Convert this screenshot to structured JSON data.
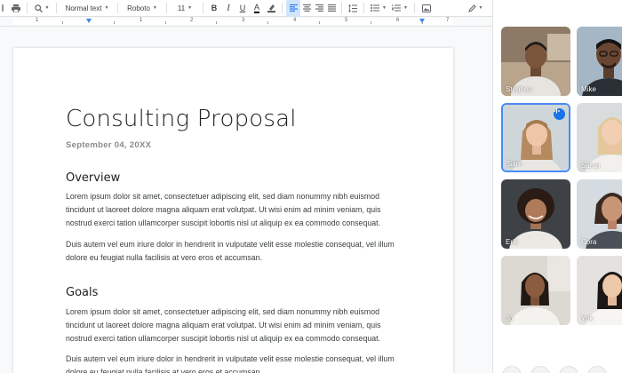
{
  "toolbar": {
    "style_select": "Normal text",
    "font_select": "Roboto",
    "font_size": "11",
    "bold": "B",
    "italic": "I",
    "underline": "U",
    "text_color": "A"
  },
  "ruler": {
    "labels": [
      "1",
      "1",
      "2",
      "3",
      "4",
      "5",
      "6",
      "7"
    ]
  },
  "document": {
    "title": "Consulting Proposal",
    "date": "September 04, 20XX",
    "sections": [
      {
        "heading": "Overview",
        "paragraphs": [
          "Lorem ipsum dolor sit amet, consectetuer adipiscing elit, sed diam nonummy nibh euismod tincidunt ut laoreet dolore magna aliquam erat volutpat. Ut wisi enim ad minim veniam, quis nostrud exerci tation ullamcorper suscipit lobortis nisl ut aliquip ex ea commodo consequat.",
          "Duis autem vel eum iriure dolor in hendrerit in vulputate velit esse molestie consequat, vel illum dolore eu feugiat nulla facilisis at vero eros et accumsan."
        ]
      },
      {
        "heading": "Goals",
        "paragraphs": [
          "Lorem ipsum dolor sit amet, consectetuer adipiscing elit, sed diam nonummy nibh euismod tincidunt ut laoreet dolore magna aliquam erat volutpat. Ut wisi enim ad minim veniam, quis nostrud exerci tation ullamcorper suscipit lobortis nisl ut aliquip ex ea commodo consequat.",
          "Duis autem vel eum iriure dolor in hendrerit in vulputate velit esse molestie consequat, vel illum dolore eu feugiat nulla facilisis at vero eros et accumsan."
        ]
      }
    ]
  },
  "meet": {
    "participants": [
      {
        "name": "Stephen",
        "speaking": false
      },
      {
        "name": "Mike",
        "speaking": false
      },
      {
        "name": "Sam",
        "speaking": true
      },
      {
        "name": "Sarah",
        "speaking": false
      },
      {
        "name": "Erik",
        "speaking": false
      },
      {
        "name": "Cora",
        "speaking": false
      },
      {
        "name": "Jo",
        "speaking": false
      },
      {
        "name": "Yuk",
        "speaking": false
      }
    ],
    "colors": {
      "accent": "#1a73e8",
      "speaking_border": "#4a8af4"
    }
  }
}
